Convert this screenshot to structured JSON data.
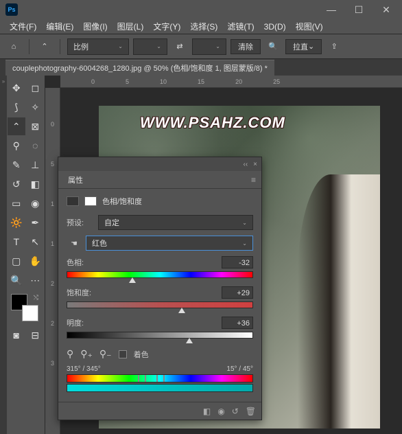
{
  "menubar": {
    "file": "文件(F)",
    "edit": "编辑(E)",
    "image": "图像(I)",
    "layer": "图层(L)",
    "type": "文字(Y)",
    "select": "选择(S)",
    "filter": "滤镜(T)",
    "threed": "3D(D)",
    "view": "视图(V)"
  },
  "optbar": {
    "ratio": "比例",
    "clear": "清除",
    "straighten": "拉直"
  },
  "doc": {
    "title": "couplephotography-6004268_1280.jpg @ 50% (色相/饱和度 1, 图层蒙版/8) *"
  },
  "image": {
    "watermark": "WWW.PSAHZ.COM"
  },
  "ruler_h": [
    "0",
    "5",
    "10",
    "15",
    "20",
    "25"
  ],
  "ruler_v": [
    "0",
    "5",
    "1",
    "1",
    "2",
    "2",
    "3"
  ],
  "panel": {
    "tab": "属性",
    "adj_title": "色相/饱和度",
    "preset_label": "预设:",
    "preset_value": "自定",
    "channel_value": "红色",
    "hue": {
      "label": "色相:",
      "value": "-32",
      "pos": 35
    },
    "sat": {
      "label": "饱和度:",
      "value": "+29",
      "pos": 62
    },
    "light": {
      "label": "明度:",
      "value": "+36",
      "pos": 66
    },
    "colorize": "着色",
    "range_left": "315° / 345°",
    "range_right": "15° / 45°"
  }
}
